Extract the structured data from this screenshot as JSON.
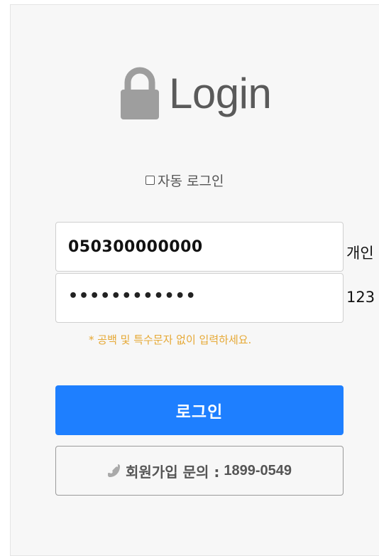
{
  "header": {
    "title": "Login",
    "icon": "lock-icon"
  },
  "auto_login": {
    "label": "자동 로그인",
    "checked": false
  },
  "form": {
    "id_value": "050300000000",
    "password_masked": "••••••••••••",
    "hint": "* 공백 및 특수문자 없이 입력하세요."
  },
  "side_labels": {
    "line1": "개인",
    "line2": "123"
  },
  "buttons": {
    "login_label": "로그인",
    "join_label": "회원가입 문의 :",
    "join_number": "1899-0549",
    "join_icon": "phone-icon"
  },
  "colors": {
    "primary": "#1e7fff",
    "hint": "#e6a834",
    "title": "#5a5a5a"
  }
}
